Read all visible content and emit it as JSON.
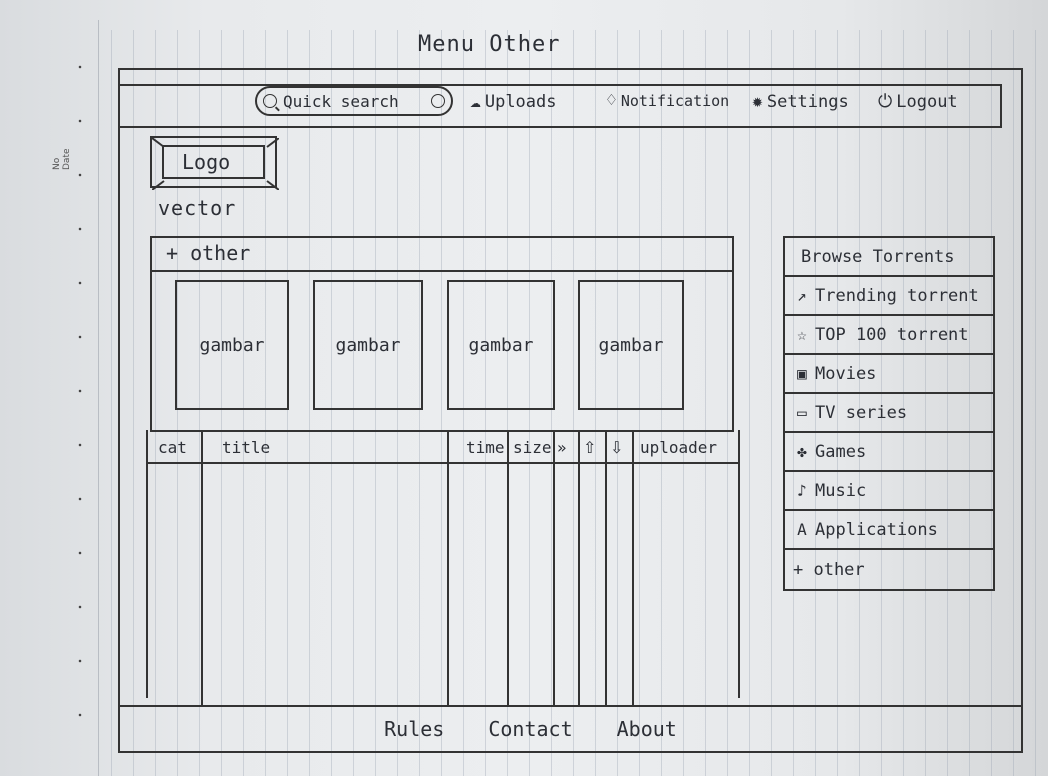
{
  "sheet": {
    "title": "Menu Other",
    "margin_labels": [
      "No",
      "Date"
    ]
  },
  "header": {
    "search": {
      "label": "Quick search",
      "icon": "search-icon",
      "go_icon": "go-circle-icon"
    },
    "links": [
      {
        "label": "Uploads",
        "icon": "upload-cloud-icon"
      },
      {
        "label": "Notification",
        "icon": "bell-icon"
      },
      {
        "label": "Settings",
        "icon": "gear-icon"
      },
      {
        "label": "Logout",
        "icon": "power-icon"
      }
    ]
  },
  "logo": {
    "label": "Logo",
    "caption": "vector"
  },
  "main": {
    "panel_title": "+ other",
    "thumbnails": [
      "gambar",
      "gambar",
      "gambar",
      "gambar"
    ],
    "table": {
      "columns": [
        {
          "label": "cat"
        },
        {
          "label": "title"
        },
        {
          "label": "time"
        },
        {
          "label": "size"
        },
        {
          "label": "",
          "icon": "share-arrows-icon"
        },
        {
          "label": "",
          "icon": "arrow-up-icon"
        },
        {
          "label": "",
          "icon": "arrow-down-icon"
        },
        {
          "label": "uploader"
        }
      ],
      "rows": []
    }
  },
  "sidebar": {
    "title": "Browse Torrents",
    "items": [
      {
        "label": "Trending torrent",
        "icon": "trend-arrow-icon"
      },
      {
        "label": "TOP 100 torrent",
        "icon": "star-icon"
      },
      {
        "label": "Movies",
        "icon": "film-icon"
      },
      {
        "label": "TV series",
        "icon": "tv-icon"
      },
      {
        "label": "Games",
        "icon": "gamepad-icon"
      },
      {
        "label": "Music",
        "icon": "music-note-icon"
      },
      {
        "label": "Applications",
        "icon": "app-letter-icon"
      },
      {
        "label": "+ other",
        "icon": ""
      }
    ]
  },
  "footer": {
    "links": [
      "Rules",
      "Contact",
      "About"
    ]
  }
}
